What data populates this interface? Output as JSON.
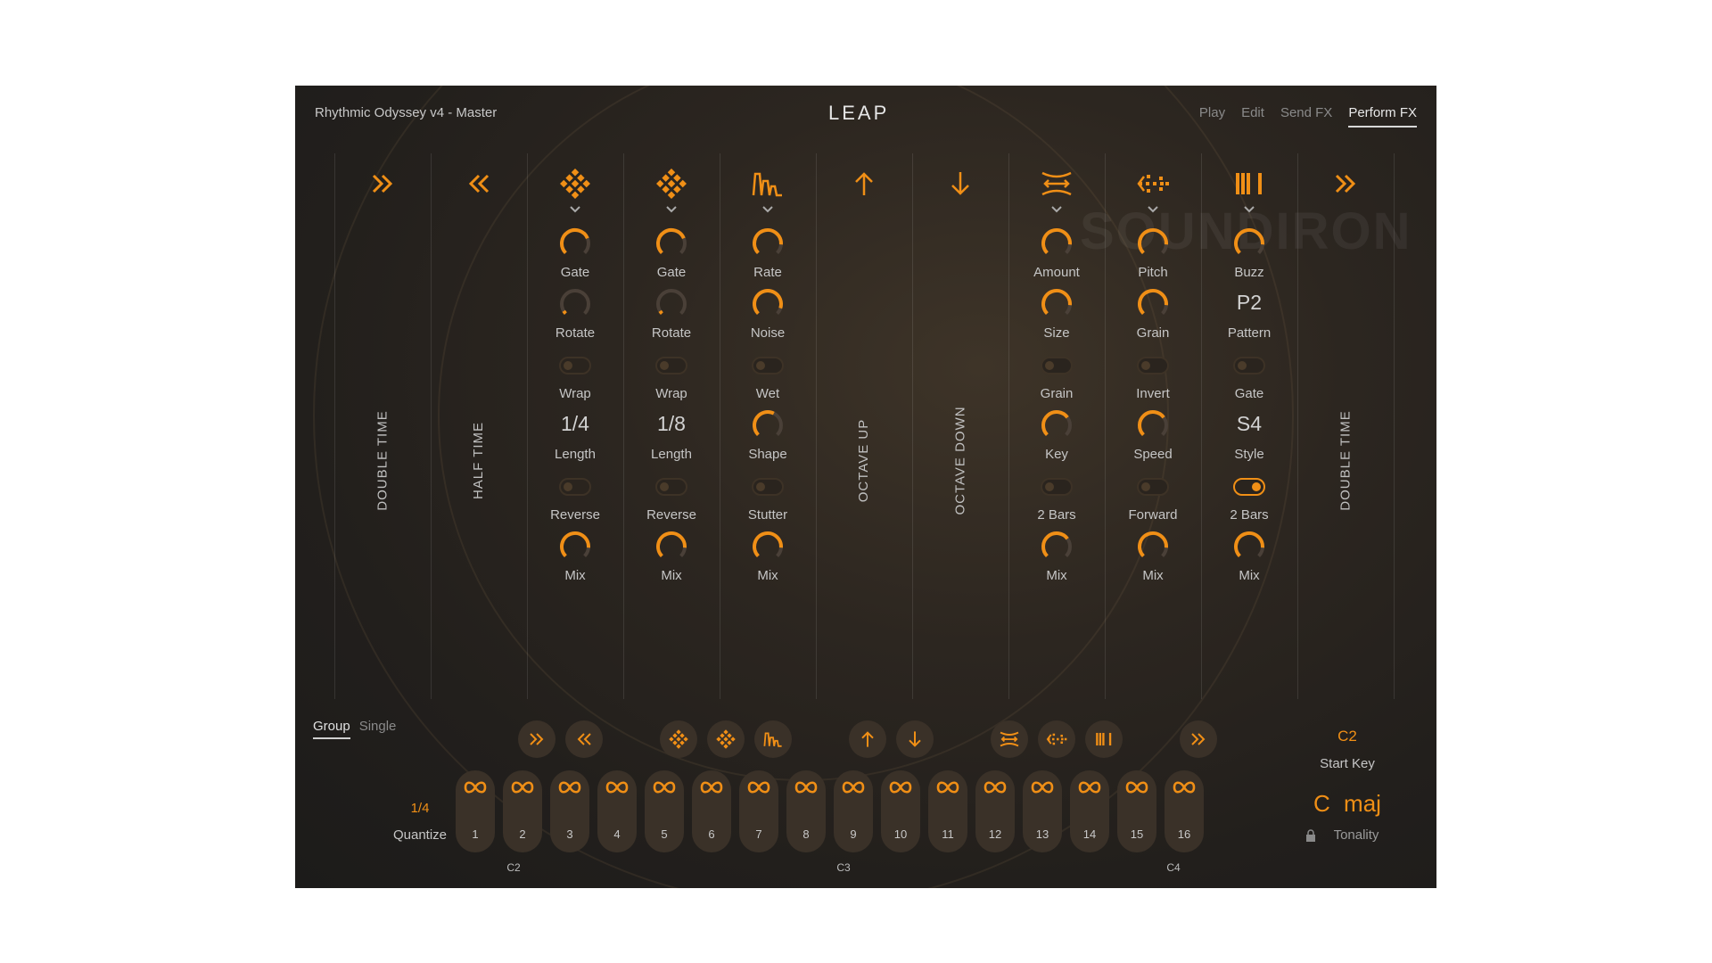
{
  "app": {
    "title": "Rhythmic Odyssey v4 - Master",
    "logo": "LEAP",
    "watermark": "SOUNDIRON"
  },
  "nav": {
    "tabs": [
      {
        "label": "Play",
        "active": false
      },
      {
        "label": "Edit",
        "active": false
      },
      {
        "label": "Send FX",
        "active": false
      },
      {
        "label": "Perform FX",
        "active": true
      }
    ]
  },
  "colors": {
    "accent": "#f08f16",
    "panel_bg": "#221f1c",
    "text": "#c6c6c6"
  },
  "columns": {
    "c0": {
      "icon": "double-chevron-right-icon",
      "vertical_label": "DOUBLE  TIME"
    },
    "c1": {
      "icon": "double-chevron-left-icon",
      "vertical_label": "HALF  TIME"
    },
    "c2": {
      "icon": "diamond-grid-icon",
      "controls": [
        {
          "type": "knob",
          "label": "Gate",
          "value": 0.75
        },
        {
          "type": "knob",
          "label": "Rotate",
          "value": 0.05
        },
        {
          "type": "toggle",
          "label": "Wrap",
          "on": false
        },
        {
          "type": "text",
          "label": "Length",
          "value": "1/4"
        },
        {
          "type": "toggle",
          "label": "Reverse",
          "on": false
        },
        {
          "type": "knob",
          "label": "Mix",
          "value": 0.85
        }
      ]
    },
    "c3": {
      "icon": "diamond-grid-icon",
      "controls": [
        {
          "type": "knob",
          "label": "Gate",
          "value": 0.75
        },
        {
          "type": "knob",
          "label": "Rotate",
          "value": 0.05
        },
        {
          "type": "toggle",
          "label": "Wrap",
          "on": false
        },
        {
          "type": "text",
          "label": "Length",
          "value": "1/8"
        },
        {
          "type": "toggle",
          "label": "Reverse",
          "on": false
        },
        {
          "type": "knob",
          "label": "Mix",
          "value": 0.85
        }
      ]
    },
    "c4": {
      "icon": "waveform-icon",
      "controls": [
        {
          "type": "knob",
          "label": "Rate",
          "value": 0.85
        },
        {
          "type": "knob",
          "label": "Noise",
          "value": 0.9
        },
        {
          "type": "toggle",
          "label": "Wet",
          "on": false
        },
        {
          "type": "knob",
          "label": "Shape",
          "value": 0.6
        },
        {
          "type": "toggle",
          "label": "Stutter",
          "on": false
        },
        {
          "type": "knob",
          "label": "Mix",
          "value": 0.85
        }
      ]
    },
    "c5": {
      "icon": "arrow-up-icon",
      "vertical_label": "OCTAVE  UP"
    },
    "c6": {
      "icon": "arrow-down-icon",
      "vertical_label": "OCTAVE  DOWN"
    },
    "c7": {
      "icon": "stretch-icon",
      "controls": [
        {
          "type": "knob",
          "label": "Amount",
          "value": 0.85
        },
        {
          "type": "knob",
          "label": "Size",
          "value": 0.85
        },
        {
          "type": "toggle",
          "label": "Grain",
          "on": false
        },
        {
          "type": "knob",
          "label": "Key",
          "value": 0.7
        },
        {
          "type": "toggle",
          "label": "2 Bars",
          "on": false
        },
        {
          "type": "knob",
          "label": "Mix",
          "value": 0.7
        }
      ]
    },
    "c8": {
      "icon": "scatter-arrow-icon",
      "controls": [
        {
          "type": "knob",
          "label": "Pitch",
          "value": 0.85
        },
        {
          "type": "knob",
          "label": "Grain",
          "value": 0.85
        },
        {
          "type": "toggle",
          "label": "Invert",
          "on": false
        },
        {
          "type": "knob",
          "label": "Speed",
          "value": 0.7
        },
        {
          "type": "toggle",
          "label": "Forward",
          "on": false
        },
        {
          "type": "knob",
          "label": "Mix",
          "value": 0.85
        }
      ]
    },
    "c9": {
      "icon": "bars-icon",
      "controls": [
        {
          "type": "knob",
          "label": "Buzz",
          "value": 0.85
        },
        {
          "type": "text",
          "label": "Pattern",
          "value": "P2"
        },
        {
          "type": "toggle",
          "label": "Gate",
          "on": false
        },
        {
          "type": "text",
          "label": "Style",
          "value": "S4"
        },
        {
          "type": "toggle",
          "label": "2 Bars",
          "on": true
        },
        {
          "type": "knob",
          "label": "Mix",
          "value": 0.85
        }
      ]
    },
    "c10": {
      "icon": "double-chevron-right-icon",
      "vertical_label": "DOUBLE  TIME"
    }
  },
  "mode": {
    "tabs": [
      {
        "label": "Group",
        "active": true
      },
      {
        "label": "Single",
        "active": false
      }
    ]
  },
  "quantize": {
    "value": "1/4",
    "label": "Quantize"
  },
  "pads": [
    "1",
    "2",
    "3",
    "4",
    "5",
    "6",
    "7",
    "8",
    "9",
    "10",
    "11",
    "12",
    "13",
    "14",
    "15",
    "16"
  ],
  "note_labels": [
    "C2",
    "C3",
    "C4"
  ],
  "start_key": {
    "value": "C2",
    "label": "Start Key"
  },
  "tonality": {
    "value": "C  maj",
    "label": "Tonality"
  }
}
